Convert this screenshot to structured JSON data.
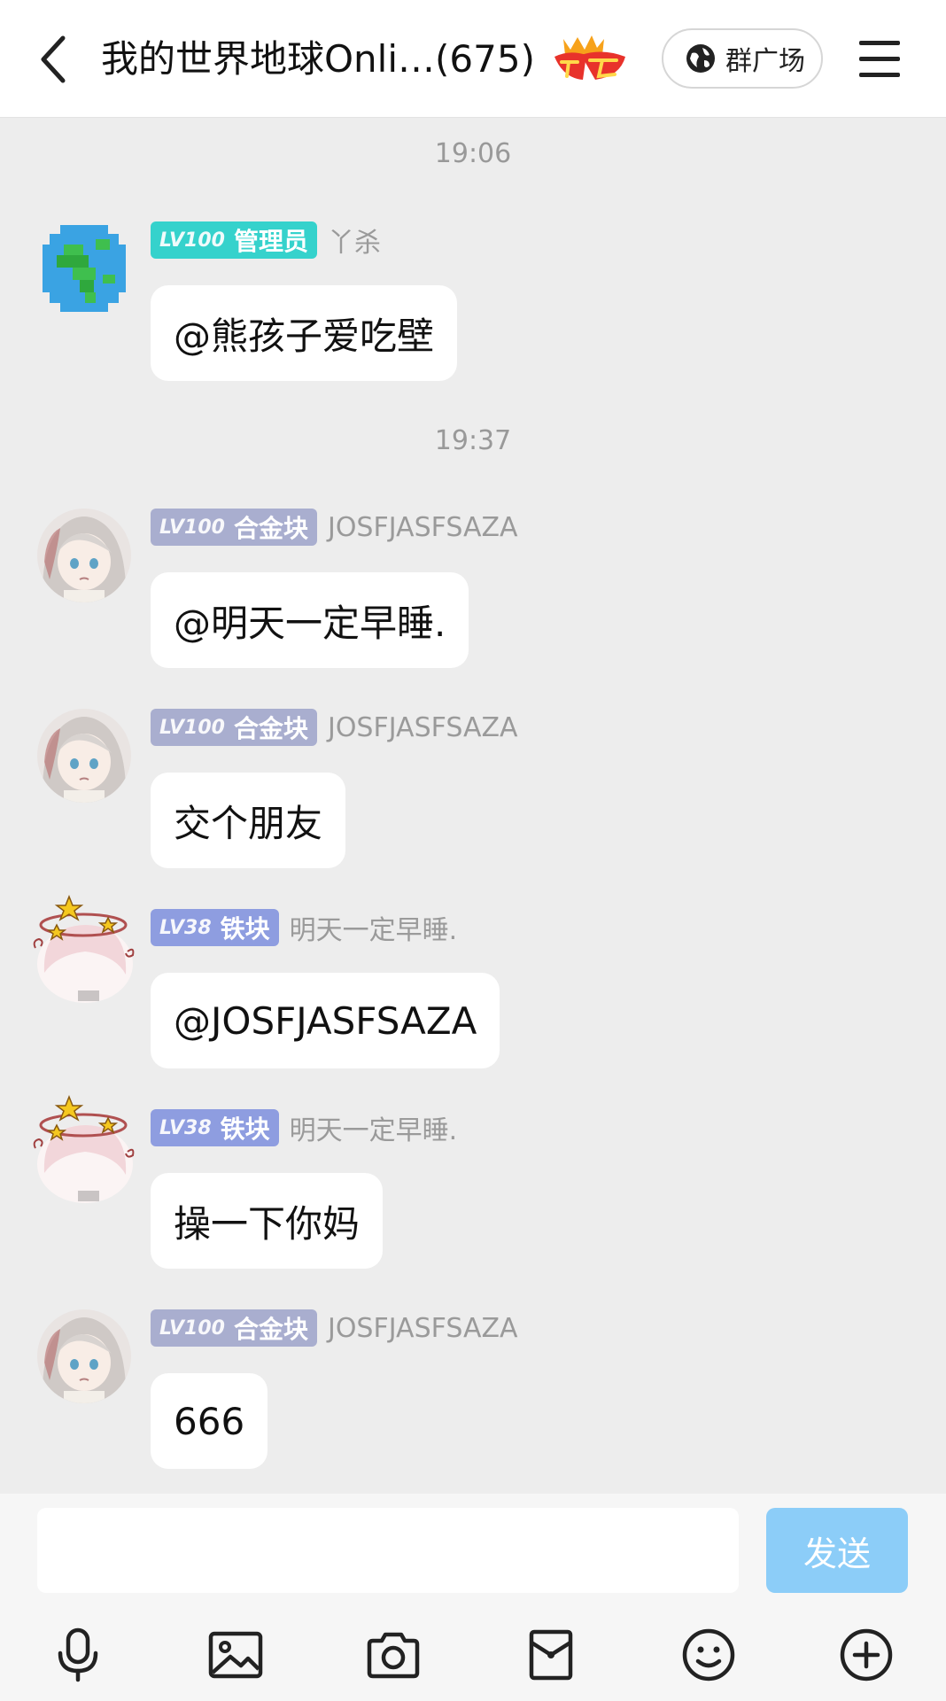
{
  "header": {
    "title": "我的世界地球Onli…(675)",
    "plaza_label": "群广场",
    "icons": [
      "back-arrow-icon",
      "king-badge-icon",
      "globe-icon",
      "menu-icon"
    ]
  },
  "timestamps": [
    "19:06",
    "19:37"
  ],
  "messages": [
    {
      "level": "LV100",
      "role": "管理员",
      "badge_color": "#35d2cc",
      "name": "丫杀",
      "text": "@熊孩子爱吃壁"
    },
    {
      "level": "LV100",
      "role": "合金块",
      "badge_color": "#a9aecf",
      "name": "JOSFJASFSAZA",
      "text": "@明天一定早睡."
    },
    {
      "level": "LV100",
      "role": "合金块",
      "badge_color": "#a9aecf",
      "name": "JOSFJASFSAZA",
      "text": "交个朋友"
    },
    {
      "level": "LV38",
      "role": "铁块",
      "badge_color": "#8e9de0",
      "name": "明天一定早睡.",
      "text": "@JOSFJASFSAZA"
    },
    {
      "level": "LV38",
      "role": "铁块",
      "badge_color": "#8e9de0",
      "name": "明天一定早睡.",
      "text": "操一下你妈"
    },
    {
      "level": "LV100",
      "role": "合金块",
      "badge_color": "#a9aecf",
      "name": "JOSFJASFSAZA",
      "text": "666"
    }
  ],
  "input": {
    "value": "",
    "placeholder": ""
  },
  "send_label": "发送",
  "toolbar": [
    "microphone-icon",
    "image-icon",
    "camera-icon",
    "red-packet-icon",
    "emoji-icon",
    "plus-icon"
  ],
  "colors": {
    "send_button": "#8ccdf8",
    "background": "#ededed"
  }
}
